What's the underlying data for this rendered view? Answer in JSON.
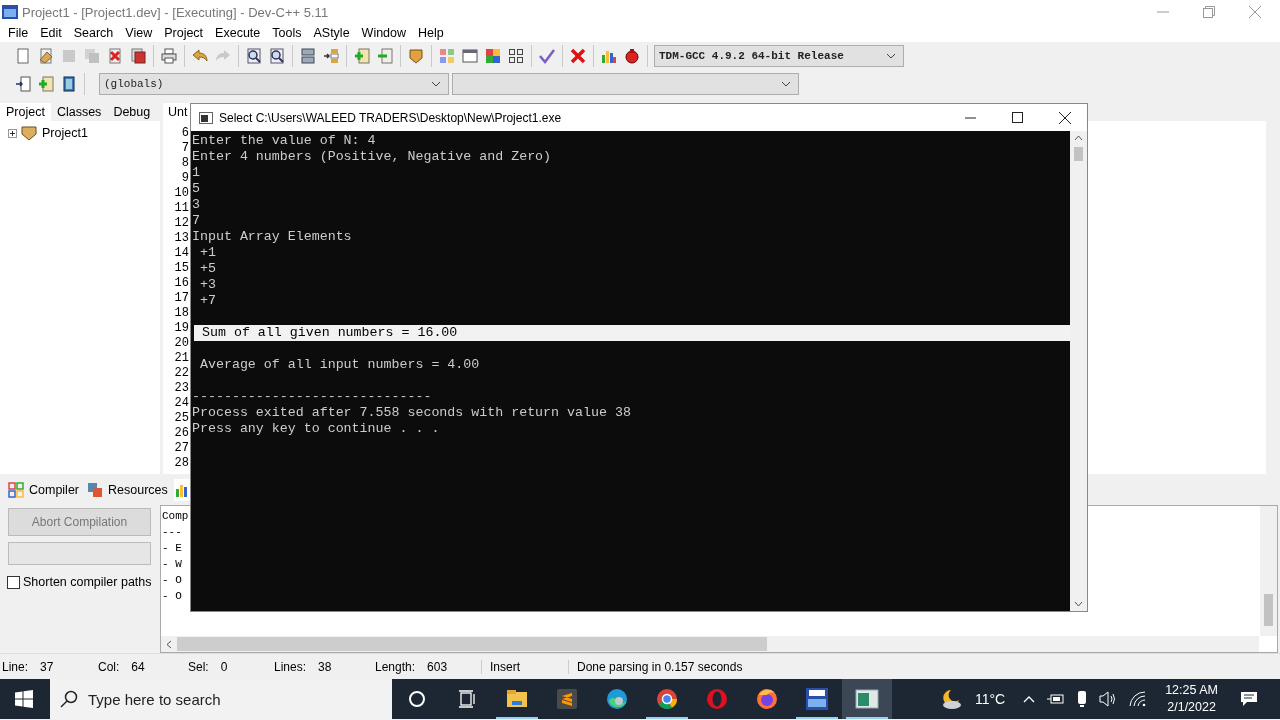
{
  "window": {
    "title": "Project1 - [Project1.dev] - [Executing] - Dev-C++ 5.11"
  },
  "menu": [
    "File",
    "Edit",
    "Search",
    "View",
    "Project",
    "Execute",
    "Tools",
    "AStyle",
    "Window",
    "Help"
  ],
  "toolbar": [
    [
      {
        "kind": "new",
        "disabled": false
      },
      {
        "kind": "open",
        "disabled": false
      },
      {
        "kind": "save",
        "disabled": true
      },
      {
        "kind": "save-all",
        "disabled": true
      },
      {
        "kind": "close",
        "disabled": false
      },
      {
        "kind": "close-all",
        "disabled": false
      }
    ],
    [
      {
        "kind": "print",
        "disabled": false
      }
    ],
    [
      {
        "kind": "undo",
        "disabled": false
      },
      {
        "kind": "redo",
        "disabled": true
      }
    ],
    [
      {
        "kind": "find",
        "disabled": false
      },
      {
        "kind": "replace",
        "disabled": false
      }
    ],
    [
      {
        "kind": "goto",
        "disabled": false
      },
      {
        "kind": "indent",
        "disabled": false
      }
    ],
    [
      {
        "kind": "add",
        "disabled": false
      },
      {
        "kind": "remove",
        "disabled": false
      }
    ],
    [
      {
        "kind": "badge",
        "disabled": false
      }
    ],
    [
      {
        "kind": "tiles",
        "disabled": false
      },
      {
        "kind": "window",
        "disabled": false
      },
      {
        "kind": "colors",
        "disabled": false
      },
      {
        "kind": "grid",
        "disabled": false
      }
    ],
    [
      {
        "kind": "check",
        "disabled": false
      }
    ],
    [
      {
        "kind": "delete",
        "disabled": false
      }
    ],
    [
      {
        "kind": "chart",
        "disabled": false
      },
      {
        "kind": "profile",
        "disabled": false
      }
    ]
  ],
  "compiler_select": {
    "value": "TDM-GCC 4.9.2 64-bit Release"
  },
  "toolbar_2": [
    {
      "kind": "insert",
      "disabled": false
    },
    {
      "kind": "add",
      "disabled": false
    },
    {
      "kind": "book",
      "disabled": false
    }
  ],
  "scope_select": {
    "value": "(globals)"
  },
  "left_tabs": [
    {
      "label": "Project",
      "selected": true
    },
    {
      "label": "Classes",
      "selected": false
    },
    {
      "label": "Debug",
      "selected": false
    }
  ],
  "project_tree": [
    {
      "label": "Project1",
      "expanded": false
    }
  ],
  "editor": {
    "tab": "Unt",
    "line_numbers": [
      "6",
      "7",
      "8",
      "9",
      "10",
      "11",
      "12",
      "13",
      "14",
      "15",
      "16",
      "17",
      "18",
      "19",
      "20",
      "21",
      "22",
      "23",
      "24",
      "25",
      "26",
      "27",
      "28"
    ]
  },
  "console": {
    "title": "Select C:\\Users\\WALEED TRADERS\\Desktop\\New\\Project1.exe",
    "lines": [
      {
        "kind": "text",
        "text": "Enter the value of N: 4",
        "selected": false
      },
      {
        "kind": "text",
        "text": "Enter 4 numbers (Positive, Negative and Zero)",
        "selected": false
      },
      {
        "kind": "text",
        "text": "1",
        "selected": false
      },
      {
        "kind": "text",
        "text": "5",
        "selected": false
      },
      {
        "kind": "text",
        "text": "3",
        "selected": false
      },
      {
        "kind": "text",
        "text": "7",
        "selected": false
      },
      {
        "kind": "text",
        "text": "Input Array Elements",
        "selected": false
      },
      {
        "kind": "text",
        "text": " +1",
        "selected": false
      },
      {
        "kind": "text",
        "text": " +5",
        "selected": false
      },
      {
        "kind": "text",
        "text": " +3",
        "selected": false
      },
      {
        "kind": "text",
        "text": " +7",
        "selected": false
      },
      {
        "kind": "blank",
        "selected": false
      },
      {
        "kind": "text",
        "text": " Sum of all given numbers = 16.00",
        "selected": true
      },
      {
        "kind": "blank",
        "selected": false
      },
      {
        "kind": "text",
        "text": " Average of all input numbers = 4.00",
        "selected": false
      },
      {
        "kind": "blank",
        "selected": false
      },
      {
        "kind": "text",
        "text": "------------------------------",
        "selected": false
      },
      {
        "kind": "text",
        "text": "Process exited after 7.558 seconds with return value 38",
        "selected": false
      },
      {
        "kind": "text",
        "text": "Press any key to continue . . .",
        "selected": false
      }
    ]
  },
  "bottom_tabs": [
    {
      "kind": "compiler",
      "label": "Compiler",
      "selected": false
    },
    {
      "kind": "resources",
      "label": "Resources",
      "selected": false
    },
    {
      "kind": "log",
      "selected": true
    }
  ],
  "abort_button": {
    "label": "Abort Compilation",
    "disabled": true
  },
  "progress": {
    "level": 0
  },
  "shorten_paths": {
    "label": "Shorten compiler paths",
    "checked": false
  },
  "compile_log": [
    "Comp",
    "---",
    "- E",
    "- W",
    "- O",
    "- O"
  ],
  "status_bar": [
    {
      "label": "Line:",
      "value": "37"
    },
    {
      "label": "Col:",
      "value": "64"
    },
    {
      "label": "Sel:",
      "value": "0"
    },
    {
      "label": "Lines:",
      "value": "38"
    },
    {
      "label": "Length:",
      "value": "603"
    },
    {
      "label": "Insert"
    },
    {
      "label": "Done parsing in 0.157 seconds"
    }
  ],
  "taskbar": {
    "search_placeholder": "Type here to search",
    "apps": [
      {
        "kind": "explorer",
        "running": true,
        "selected": false
      },
      {
        "kind": "sublime",
        "running": false,
        "selected": false
      },
      {
        "kind": "edge",
        "running": false,
        "selected": false
      },
      {
        "kind": "chrome",
        "running": true,
        "selected": false
      },
      {
        "kind": "opera",
        "running": false,
        "selected": false
      },
      {
        "kind": "firefox",
        "running": false,
        "selected": false
      },
      {
        "kind": "devcpp",
        "running": true,
        "selected": false
      },
      {
        "kind": "console",
        "running": true,
        "selected": true
      }
    ],
    "weather": "11°C",
    "time": "12:25 AM",
    "date": "2/1/2022"
  }
}
